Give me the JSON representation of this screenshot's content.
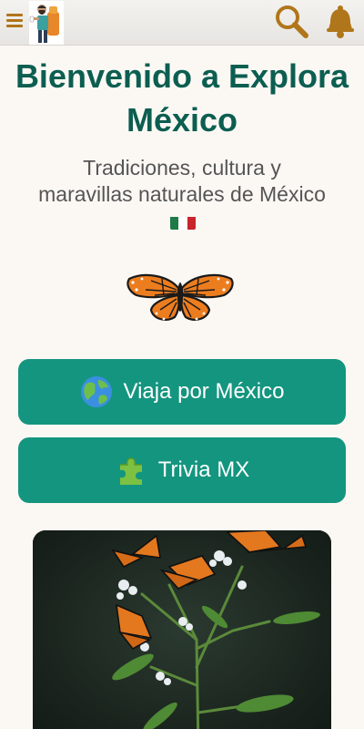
{
  "header": {
    "menu_icon": "hamburger-icon",
    "avatar_icon": "hiker-avatar-icon",
    "search_icon": "search-icon",
    "notifications_icon": "bell-icon"
  },
  "main": {
    "title": "Bienvenido a Explora México",
    "subtitle": "Tradiciones, cultura y maravillas naturales de México",
    "subtitle_emoji": "mexico-flag-icon"
  },
  "buttons": [
    {
      "label": "Viaja por México",
      "icon": "globe-icon"
    },
    {
      "label": "Trivia MX",
      "icon": "puzzle-piece-icon"
    }
  ],
  "colors": {
    "accent": "#14957f",
    "title": "#0c5e50",
    "icon_gold": "#b0761b",
    "background": "#fbf8f4"
  }
}
